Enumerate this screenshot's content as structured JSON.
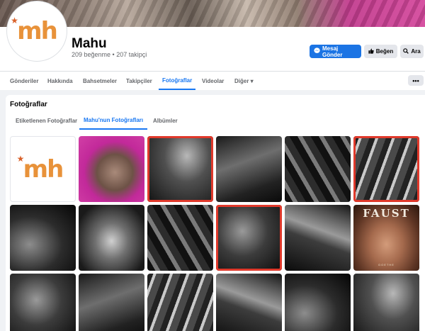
{
  "page": {
    "name": "Mahu",
    "stats": "209 beğenme • 207 takipçi",
    "logo_text": "mh",
    "logo_star": "★"
  },
  "actions": {
    "message": "Mesaj Gönder",
    "like": "Beğen",
    "search": "Ara",
    "message_icon": "messenger-icon",
    "like_icon": "thumbs-up-icon",
    "search_icon": "search-icon"
  },
  "tabs": [
    {
      "label": "Gönderiler"
    },
    {
      "label": "Hakkında"
    },
    {
      "label": "Bahsetmeler"
    },
    {
      "label": "Takipçiler"
    },
    {
      "label": "Fotoğraflar",
      "active": true
    },
    {
      "label": "Videolar"
    },
    {
      "label": "Diğer ▾"
    }
  ],
  "more_label": "•••",
  "photos": {
    "title": "Fotoğraflar",
    "subtabs": [
      {
        "label": "Etiketlenen Fotoğraflar"
      },
      {
        "label": "Mahu'nun Fotoğrafları",
        "active": true
      },
      {
        "label": "Albümler"
      }
    ],
    "faust_title": "FAUST",
    "faust_subtitle": "GOETHE"
  },
  "colors": {
    "accent": "#1877f2",
    "selection": "#e0392b",
    "brand": "#e8923a"
  }
}
